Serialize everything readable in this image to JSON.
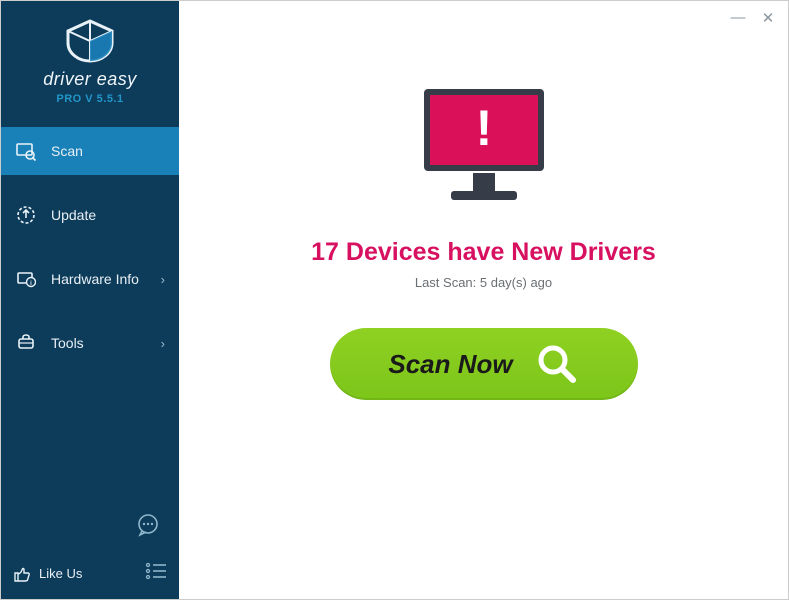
{
  "brand": {
    "name": "driver easy",
    "version": "PRO V 5.5.1"
  },
  "sidebar": {
    "items": [
      {
        "label": "Scan",
        "icon": "scan-icon",
        "has_caret": false
      },
      {
        "label": "Update",
        "icon": "update-icon",
        "has_caret": false
      },
      {
        "label": "Hardware Info",
        "icon": "hardware-icon",
        "has_caret": true
      },
      {
        "label": "Tools",
        "icon": "tools-icon",
        "has_caret": true
      }
    ],
    "like_us": "Like Us"
  },
  "main": {
    "headline": "17 Devices have New Drivers",
    "last_scan": "Last Scan: 5 day(s) ago",
    "scan_button": "Scan Now"
  },
  "colors": {
    "accent_pink": "#d81060",
    "accent_green": "#8fd122",
    "sidebar_bg": "#0d3b5a",
    "sidebar_active": "#1a80b8"
  }
}
